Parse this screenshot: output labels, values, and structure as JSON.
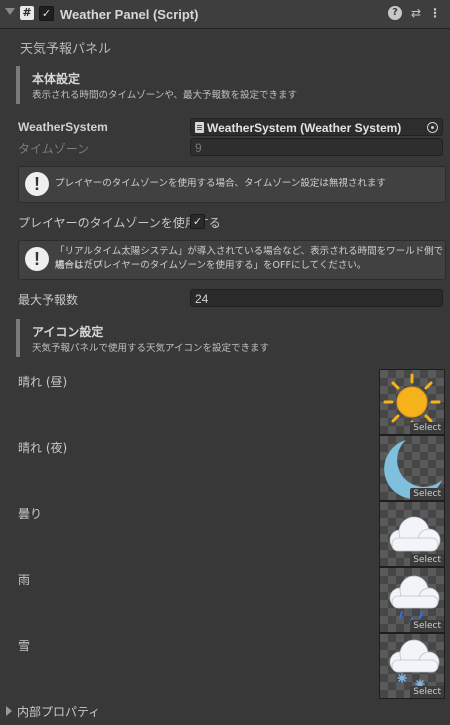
{
  "header": {
    "title": "Weather Panel (Script)",
    "script_icon": "#",
    "enabled_check": "✓",
    "help_icon": "?",
    "preset_icon": "⇄",
    "menu_icon": "⋮"
  },
  "panel_title": "天気予報パネル",
  "main_settings": {
    "title": "本体設定",
    "description": "表示される時間のタイムゾーンや、最大予報数を設定できます"
  },
  "weather_system": {
    "label": "WeatherSystem",
    "value": "WeatherSystem (Weather System)"
  },
  "timezone": {
    "label": "タイムゾーン",
    "value": "9"
  },
  "help1": {
    "icon": "!",
    "text": "プレイヤーのタイムゾーンを使用する場合、タイムゾーン設定は無視されます"
  },
  "use_player_tz": {
    "label": "プレイヤーのタイムゾーンを使用する",
    "check": "✓"
  },
  "help2": {
    "icon": "!",
    "line1": "「リアルタイム太陽システム」が導入されている場合など、表示される時間をワールド側で統一したい",
    "line2": "場合は「プレイヤーのタイムゾーンを使用する」をOFFにしてください。"
  },
  "max_forecast": {
    "label": "最大予報数",
    "value": "24"
  },
  "icon_settings": {
    "title": "アイコン設定",
    "description": "天気予報パネルで使用する天気アイコンを設定できます"
  },
  "icons": [
    {
      "label": "晴れ (昼)",
      "select": "Select",
      "icon": "sun-icon"
    },
    {
      "label": "晴れ (夜)",
      "select": "Select",
      "icon": "moon-icon"
    },
    {
      "label": "曇り",
      "select": "Select",
      "icon": "cloud-icon"
    },
    {
      "label": "雨",
      "select": "Select",
      "icon": "rain-icon"
    },
    {
      "label": "雪",
      "select": "Select",
      "icon": "snow-icon"
    }
  ],
  "footer": {
    "label": "内部プロパティ"
  },
  "colors": {
    "background": "#383838",
    "sun": "#f5b21a",
    "moon": "#7ec0dd",
    "cloud": "#f2f4f7",
    "rain": "#3a6ed8",
    "snow": "#7fb7e6"
  }
}
